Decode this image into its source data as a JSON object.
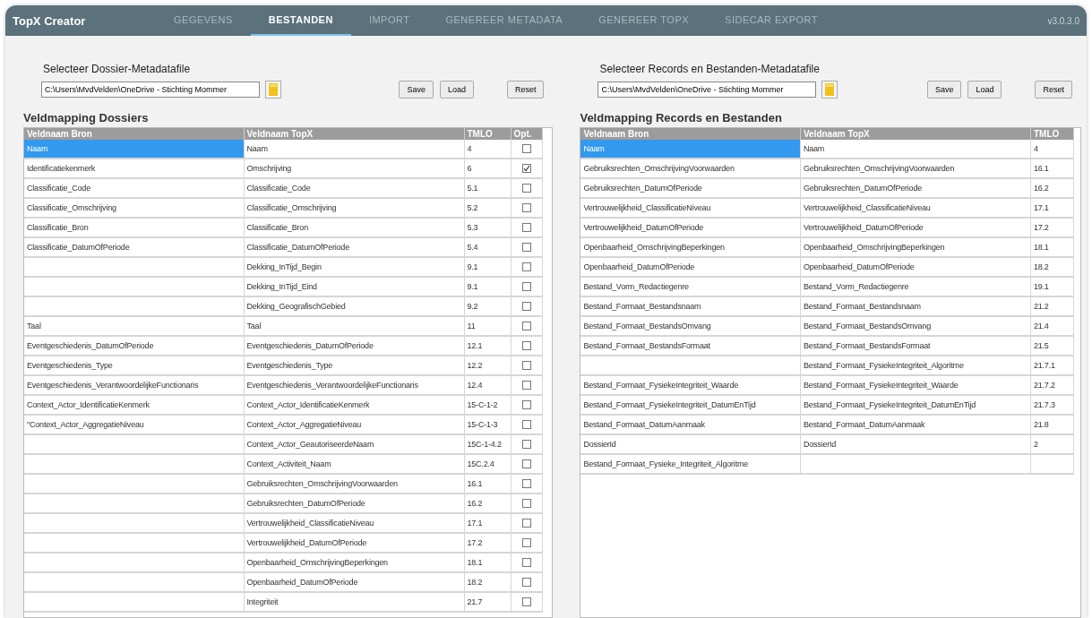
{
  "app": {
    "title": "TopX Creator",
    "version": "v3.0.3.0"
  },
  "tabs": [
    {
      "label": "GEGEVENS",
      "selected": false
    },
    {
      "label": "BESTANDEN",
      "selected": true
    },
    {
      "label": "IMPORT",
      "selected": false
    },
    {
      "label": "GENEREER METADATA",
      "selected": false
    },
    {
      "label": "GENEREER TOPX",
      "selected": false
    },
    {
      "label": "SIDECAR EXPORT",
      "selected": false
    }
  ],
  "panels": [
    {
      "file_label": "Selecteer Dossier-Metadatafile",
      "file_path": "C:\\Users\\MvdVelden\\OneDrive - Stichting Mommer",
      "buttons": [
        "Save",
        "Load",
        "Reset"
      ],
      "mapping_title": "Veldmapping Dossiers",
      "columns": [
        "Veldnaam Bron",
        "Veldnaam TopX",
        "TMLO",
        "Opt."
      ],
      "rows": [
        {
          "source": "Naam",
          "target": "Naam",
          "tmlo": "4",
          "selected": true,
          "opt": false
        },
        {
          "source": "Identificatiekenmerk",
          "target": "Omschrijving",
          "tmlo": "6",
          "selected": false,
          "opt": true
        },
        {
          "source": "Classificatie_Code",
          "target": "Classificatie_Code",
          "tmlo": "5.1",
          "selected": false,
          "opt": false
        },
        {
          "source": "Classificatie_Omschrijving",
          "target": "Classificatie_Omschrijving",
          "tmlo": "5.2",
          "selected": false,
          "opt": false
        },
        {
          "source": "Classificatie_Bron",
          "target": "Classificatie_Bron",
          "tmlo": "5.3",
          "selected": false,
          "opt": false
        },
        {
          "source": "Classificatie_DatumOfPeriode",
          "target": "Classificatie_DatumOfPeriode",
          "tmlo": "5.4",
          "selected": false,
          "opt": false
        },
        {
          "target": "Dekking_InTijd_Begin",
          "tmlo": "9.1",
          "selected": false,
          "opt": false
        },
        {
          "target": "Dekking_InTijd_Eind",
          "tmlo": "9.1",
          "selected": false,
          "opt": false
        },
        {
          "target": "Dekking_GeografischGebied",
          "tmlo": "9.2",
          "selected": false,
          "opt": false
        },
        {
          "source": "Taal",
          "target": "Taal",
          "tmlo": "11",
          "selected": false,
          "opt": false
        },
        {
          "source": "Eventgeschiedenis_DatumOfPeriode",
          "target": "Eventgeschiedenis_DatumOfPeriode",
          "tmlo": "12.1",
          "selected": false,
          "opt": false
        },
        {
          "source": "Eventgeschiedenis_Type",
          "target": "Eventgeschiedenis_Type",
          "tmlo": "12.2",
          "selected": false,
          "opt": false
        },
        {
          "source": "Eventgeschiedenis_VerantwoordelijkeFunctionaris",
          "target": "Eventgeschiedenis_VerantwoordelijkeFunctionaris",
          "tmlo": "12.4",
          "selected": false,
          "opt": false
        },
        {
          "source": "Context_Actor_IdentificatieKenmerk",
          "target": "Context_Actor_IdentificatieKenmerk",
          "tmlo": "15-C-1-2",
          "selected": false,
          "opt": false
        },
        {
          "source": "\"Context_Actor_AggregatieNiveau",
          "target": "Context_Actor_AggregatieNiveau",
          "tmlo": "15-C-1-3",
          "selected": false,
          "opt": false
        },
        {
          "target": "Context_Actor_GeautoriseerdeNaam",
          "tmlo": "15C-1-4.2",
          "selected": false,
          "opt": false
        },
        {
          "target": "Context_Activiteit_Naam",
          "tmlo": "15C.2.4",
          "selected": false,
          "opt": false
        },
        {
          "target": "Gebruiksrechten_OmschrijvingVoorwaarden",
          "tmlo": "16.1",
          "selected": false,
          "opt": false
        },
        {
          "target": "Gebruiksrechten_DatumOfPeriode",
          "tmlo": "16.2",
          "selected": false,
          "opt": false
        },
        {
          "target": "Vertrouwelijkheid_ClassificatieNiveau",
          "tmlo": "17.1",
          "selected": false,
          "opt": false
        },
        {
          "target": "Vertrouwelijkheid_DatumOfPeriode",
          "tmlo": "17.2",
          "selected": false,
          "opt": false
        },
        {
          "target": "Openbaarheid_OmschrijvingBeperkingen",
          "tmlo": "18.1",
          "selected": false,
          "opt": false
        },
        {
          "target": "Openbaarheid_DatumOfPeriode",
          "tmlo": "18.2",
          "selected": false,
          "opt": false
        },
        {
          "target": "Integriteit",
          "tmlo": "21.7",
          "selected": false,
          "opt": false
        }
      ]
    },
    {
      "file_label": "Selecteer Records en Bestanden-Metadatafile",
      "file_path": "C:\\Users\\MvdVelden\\OneDrive - Stichting Mommer",
      "buttons": [
        "Save",
        "Load",
        "Reset"
      ],
      "mapping_title": "Veldmapping Records en Bestanden",
      "columns": [
        "Veldnaam Bron",
        "Veldnaam TopX",
        "TMLO"
      ],
      "rows": [
        {
          "source": "Naam",
          "target": "Naam",
          "tmlo": "4",
          "selected": true
        },
        {
          "source": "Gebruiksrechten_OmschrijvingVoorwaarden",
          "target": "Gebruiksrechten_OmschrijvingVoorwaarden",
          "tmlo": "16.1",
          "selected": false
        },
        {
          "source": "Gebruiksrechten_DatumOfPeriode",
          "target": "Gebruiksrechten_DatumOfPeriode",
          "tmlo": "16.2",
          "selected": false
        },
        {
          "source": "Vertrouwelijkheid_ClassificatieNiveau",
          "target": "Vertrouwelijkheid_ClassificatieNiveau",
          "tmlo": "17.1",
          "selected": false
        },
        {
          "source": "Vertrouwelijkheid_DatumOfPeriode",
          "target": "Vertrouwelijkheid_DatumOfPeriode",
          "tmlo": "17.2",
          "selected": false
        },
        {
          "source": "Openbaarheid_OmschrijvingBeperkingen",
          "target": "Openbaarheid_OmschrijvingBeperkingen",
          "tmlo": "18.1",
          "selected": false
        },
        {
          "source": "Openbaarheid_DatumOfPeriode",
          "target": "Openbaarheid_DatumOfPeriode",
          "tmlo": "18.2",
          "selected": false
        },
        {
          "source": "Bestand_Vorm_Redactiegenre",
          "target": "Bestand_Vorm_Redactiegenre",
          "tmlo": "19.1",
          "selected": false
        },
        {
          "source": "Bestand_Formaat_Bestandsnaam",
          "target": "Bestand_Formaat_Bestandsnaam",
          "tmlo": "21.2",
          "selected": false
        },
        {
          "source": "Bestand_Formaat_BestandsOmvang",
          "target": "Bestand_Formaat_BestandsOmvang",
          "tmlo": "21.4",
          "selected": false
        },
        {
          "source": "Bestand_Formaat_BestandsFormaat",
          "target": "Bestand_Formaat_BestandsFormaat",
          "tmlo": "21.5",
          "selected": false
        },
        {
          "target": "Bestand_Formaat_FysiekeIntegriteit_Algoritme",
          "tmlo": "21.7.1",
          "selected": false
        },
        {
          "source": "Bestand_Formaat_FysiekeIntegriteit_Waarde",
          "target": "Bestand_Formaat_FysiekeIntegriteit_Waarde",
          "tmlo": "21.7.2",
          "selected": false
        },
        {
          "source": "Bestand_Formaat_FysiekeIntegriteit_DatumEnTijd",
          "target": "Bestand_Formaat_FysiekeIntegriteit_DatumEnTijd",
          "tmlo": "21.7.3",
          "selected": false
        },
        {
          "source": "Bestand_Formaat_DatumAanmaak",
          "target": "Bestand_Formaat_DatumAanmaak",
          "tmlo": "21.8",
          "selected": false
        },
        {
          "source": "DossierId",
          "target": "DossierId",
          "tmlo": "2",
          "selected": false
        },
        {
          "source": "Bestand_Formaat_Fysieke_Integriteit_Algoritme",
          "selected": false
        }
      ]
    }
  ]
}
